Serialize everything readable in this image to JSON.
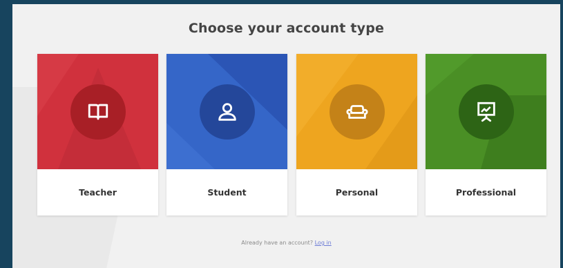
{
  "header": {
    "title": "Choose your account type"
  },
  "cards": [
    {
      "label": "Teacher",
      "icon": "book-icon",
      "color": "#d0313d",
      "shade": "#c02a36",
      "circle": "#a81f26"
    },
    {
      "label": "Student",
      "icon": "user-icon",
      "color": "#3566c8",
      "shade": "#2c58b8",
      "circle": "#24479a"
    },
    {
      "label": "Personal",
      "icon": "couch-icon",
      "color": "#eea51f",
      "shade": "#e09a1a",
      "circle": "#c48218"
    },
    {
      "label": "Professional",
      "icon": "presentation-icon",
      "color": "#4a8f25",
      "shade": "#3f801f",
      "circle": "#2d6415"
    }
  ],
  "footer": {
    "text": "Already have an account?",
    "link": "Log in"
  }
}
